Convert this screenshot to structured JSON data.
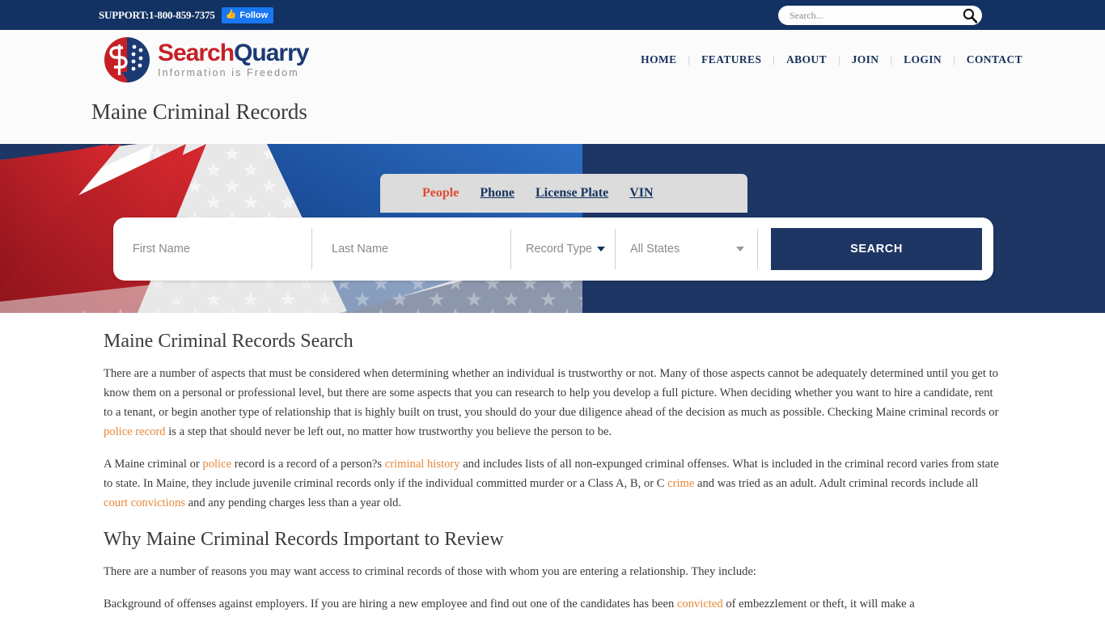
{
  "topbar": {
    "support": "SUPPORT:1-800-859-7375",
    "follow_label": "Follow",
    "follow_icon": "thumbs-up-icon",
    "search_placeholder": "Search...",
    "search_value": "",
    "search_icon": "search-icon",
    "bg_color": "#123263"
  },
  "header": {
    "logo_primary": "Search",
    "logo_secondary": "Quarry",
    "logo_tagline": "Information is Freedom",
    "brand_red": "#c62026",
    "brand_navy": "#1b3a73",
    "nav": [
      {
        "label": "HOME"
      },
      {
        "label": "FEATURES"
      },
      {
        "label": "ABOUT"
      },
      {
        "label": "JOIN"
      },
      {
        "label": "LOGIN"
      },
      {
        "label": "CONTACT"
      }
    ],
    "nav_separator": "|"
  },
  "page_title": "Maine Criminal Records",
  "hero": {
    "bg_color": "#1d3664",
    "tabs": [
      {
        "label": "People",
        "active": true
      },
      {
        "label": "Phone",
        "active": false
      },
      {
        "label": "License Plate",
        "active": false
      },
      {
        "label": "VIN",
        "active": false
      }
    ],
    "form": {
      "first_name_placeholder": "First Name",
      "first_name_value": "",
      "last_name_placeholder": "Last Name",
      "last_name_value": "",
      "record_type_label": "Record Type",
      "states_label": "All States",
      "search_button": "SEARCH",
      "button_color": "#1d3664"
    }
  },
  "main": {
    "heading1": "Maine Criminal Records Search",
    "p1_a": "There are a number of aspects that must be considered when determining whether an individual is trustworthy or not. Many of those aspects cannot be adequately determined until you get to know them on a personal or professional level, but there are some aspects that you can research to help you develop a full picture. When deciding whether you want to hire a candidate, rent to a tenant, or begin another type of relationship that is highly built on trust, you should do your due diligence ahead of the decision as much as possible. Checking Maine criminal records or ",
    "p1_link": "police record",
    "p1_b": " is a step that should never be left out, no matter how trustworthy you believe the person to be.",
    "p2_a": "A Maine criminal or ",
    "p2_link1": "police",
    "p2_b": " record is a record of a person?s ",
    "p2_link2": "criminal history",
    "p2_c": " and includes lists of all non-expunged criminal offenses. What is included in the criminal record varies from state to state. In Maine, they include juvenile criminal records only if the individual committed murder or a Class A, B, or C ",
    "p2_link3": "crime",
    "p2_d": " and was tried as an adult. Adult criminal records include all ",
    "p2_link4": "court convictions",
    "p2_e": " and any pending charges less than a year old.",
    "heading2": "Why Maine Criminal Records Important to Review",
    "p3": "There are a number of reasons you may want access to criminal records of those with whom you are entering a relationship. They include:",
    "p4_a": "Background of offenses against employers. If you are hiring a new employee and find out one of the candidates has been ",
    "p4_link": "convicted",
    "p4_b": " of embezzlement or theft, it will make a",
    "link_color": "#e8883a"
  }
}
